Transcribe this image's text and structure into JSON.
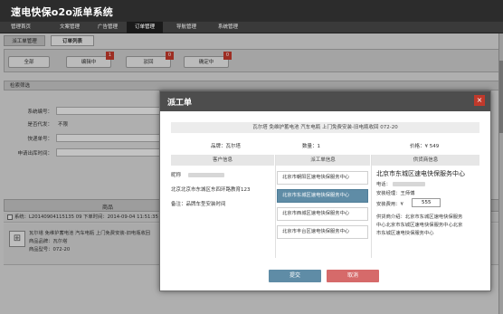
{
  "app": {
    "title": "速电快保o2o派单系统"
  },
  "nav": {
    "items": [
      {
        "label": "管理首页"
      },
      {
        "label": "文案管理"
      },
      {
        "label": "广告管理"
      },
      {
        "label": "订单管理"
      },
      {
        "label": "导航管理"
      },
      {
        "label": "系统管理"
      }
    ]
  },
  "subtabs": [
    {
      "label": "派工单管理"
    },
    {
      "label": "订单列表"
    }
  ],
  "status_buttons": [
    {
      "label": "全部",
      "badge": ""
    },
    {
      "label": "编辑中",
      "badge": "1"
    },
    {
      "label": "驳回",
      "badge": "0"
    },
    {
      "label": "确定中",
      "badge": "0"
    }
  ],
  "filter": {
    "title": "检索筛选",
    "fields": [
      {
        "label": "系统编号：",
        "value": ""
      },
      {
        "label": "是否代发：",
        "value": "不限"
      },
      {
        "label": "快递单号：",
        "value": ""
      },
      {
        "label": "申请出库时间：",
        "value": ""
      }
    ]
  },
  "table": {
    "col_product": "商品",
    "col_right": "买",
    "order_line": "系统：L20140904115135 09    下单时间：2014-09-04 11:51:35",
    "product_title": "瓦尔塔 免维护蓄电池 汽车电瓶 上门免费安装-旧电瓶收回",
    "product_brand": "商品品牌：瓦尔塔",
    "product_model": "商品型号：072-20"
  },
  "modal": {
    "title": "派工单",
    "close_icon": "×",
    "product_banner": "瓦尔塔 免维护蓄电池 汽车电瓶 上门免费安装-旧电瓶收回 072-20",
    "brand": "品牌：瓦尔塔",
    "quantity": "数量：1",
    "price": "价格：¥ 549",
    "columns": {
      "customer": "客户信息",
      "dispatch": "派工单信息",
      "provider": "供货商信息"
    },
    "customer": {
      "name_label": "昵称",
      "address": "北京北京市东城区东四环路教育123",
      "note": "备注：品牌车型安装时间"
    },
    "service_centers": [
      {
        "name": "北京市朝阳区速电快保服务中心"
      },
      {
        "name": "北京市东城区速电快保服务中心"
      },
      {
        "name": "北京市西城区速电快保服务中心"
      },
      {
        "name": "北京市丰台区速电快保服务中心"
      }
    ],
    "provider": {
      "phone_label": "电话：",
      "name": "北京市东城区速电快保服务中心",
      "contact": "安装经理：王师傅",
      "fee_label": "安装费用：¥",
      "fee_value": "555",
      "desc_1": "供货商介绍：北京市东城区速电快保服务",
      "desc_2": "中心北京市东城区速电快保服务中心北京",
      "desc_3": "市东城区速电快保服务中心"
    },
    "submit_label": "提交",
    "cancel_label": "取消"
  }
}
